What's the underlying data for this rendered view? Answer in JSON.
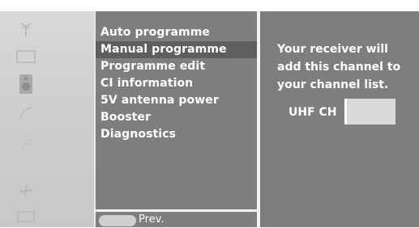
{
  "menu": {
    "items": [
      {
        "label": "Auto programme"
      },
      {
        "label": "Manual programme",
        "selected": true
      },
      {
        "label": "Programme edit"
      },
      {
        "label": "CI information"
      },
      {
        "label": "5V antenna power"
      },
      {
        "label": "Booster"
      },
      {
        "label": "Diagnostics"
      }
    ]
  },
  "footer": {
    "prev_label": "Prev."
  },
  "info": {
    "lines": [
      "Your receiver will",
      "add this channel to",
      "your channel list."
    ],
    "channel_label": "UHF CH",
    "channel_value": ""
  },
  "rail": {
    "icons": [
      "antenna-icon",
      "picture-icon",
      "speaker-icon",
      "clock-icon",
      "key-icon",
      "plane-icon",
      "screen-icon"
    ]
  },
  "colors": {
    "panel": "#7e7e7e",
    "selected": "#5e5e5e",
    "rail": "#d0d0d0",
    "text": "#ffffff"
  }
}
